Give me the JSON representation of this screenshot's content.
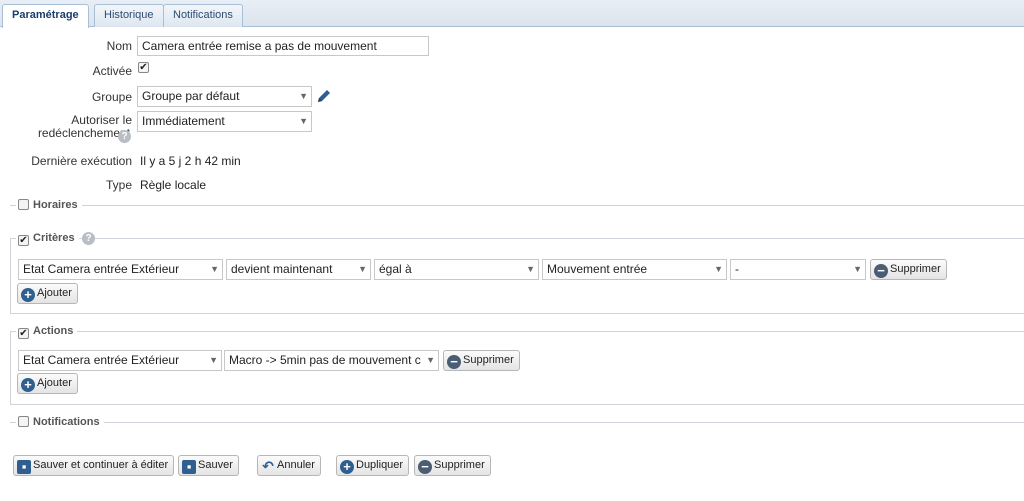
{
  "tabs": [
    "Paramétrage",
    "Historique",
    "Notifications"
  ],
  "form": {
    "nom_label": "Nom",
    "nom_value": "Camera entrée remise a pas de mouvement",
    "activee_label": "Activée",
    "activee_checked": true,
    "groupe_label": "Groupe",
    "groupe_value": "Groupe par défaut",
    "autoriser_label_1": "Autoriser le",
    "autoriser_label_2": "redéclenchement",
    "autoriser_value": "Immédiatement",
    "derniere_label": "Dernière exécution",
    "derniere_value": "Il y a 5 j 2 h 42 min",
    "type_label": "Type",
    "type_value": "Règle locale"
  },
  "sections": {
    "horaires": {
      "title": "Horaires",
      "checked": false
    },
    "criteres": {
      "title": "Critères",
      "checked": true,
      "row": [
        "Etat Camera entrée Extérieur",
        "devient maintenant",
        "égal à",
        "Mouvement entrée",
        "-"
      ],
      "delete_label": "Supprimer",
      "add_label": "Ajouter"
    },
    "actions": {
      "title": "Actions",
      "checked": true,
      "row": [
        "Etat Camera entrée Extérieur",
        "Macro -> 5min pas de mouvement c"
      ],
      "delete_label": "Supprimer",
      "add_label": "Ajouter"
    },
    "notifications": {
      "title": "Notifications",
      "checked": false
    }
  },
  "footer": {
    "save_continue": "Sauver et continuer à éditer",
    "save": "Sauver",
    "cancel": "Annuler",
    "duplicate": "Dupliquer",
    "delete": "Supprimer"
  },
  "colors": {
    "tab_border": "#a9bfd6",
    "accent": "#2f5f8f"
  }
}
